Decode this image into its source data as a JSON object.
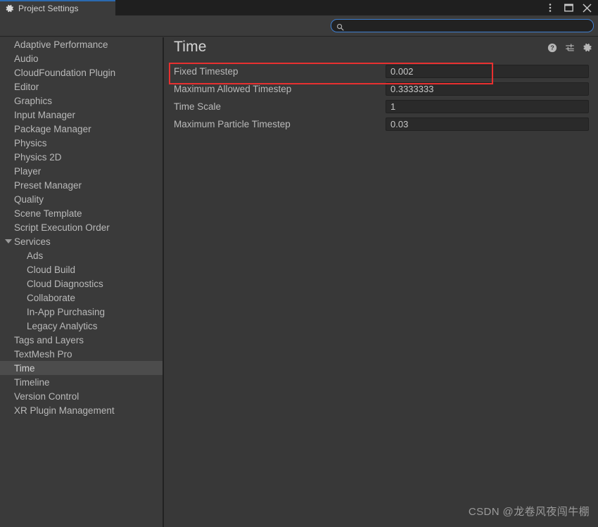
{
  "window": {
    "tab": {
      "label": "Project Settings",
      "icon": "gear-icon"
    },
    "controls": [
      {
        "name": "more-options-button",
        "icon": "kebab-menu-icon"
      },
      {
        "name": "maximize-button",
        "icon": "maximize-icon"
      },
      {
        "name": "close-button",
        "icon": "close-icon"
      }
    ],
    "accent_color": "#2b6ab0"
  },
  "search": {
    "value": "",
    "placeholder": "",
    "icon": "search-icon",
    "focus_border_color": "#3f7fd0"
  },
  "sidebar": {
    "items": [
      {
        "label": "Adaptive Performance",
        "depth": 0,
        "selected": false,
        "expandable": false
      },
      {
        "label": "Audio",
        "depth": 0,
        "selected": false,
        "expandable": false
      },
      {
        "label": "CloudFoundation Plugin",
        "depth": 0,
        "selected": false,
        "expandable": false
      },
      {
        "label": "Editor",
        "depth": 0,
        "selected": false,
        "expandable": false
      },
      {
        "label": "Graphics",
        "depth": 0,
        "selected": false,
        "expandable": false
      },
      {
        "label": "Input Manager",
        "depth": 0,
        "selected": false,
        "expandable": false
      },
      {
        "label": "Package Manager",
        "depth": 0,
        "selected": false,
        "expandable": false
      },
      {
        "label": "Physics",
        "depth": 0,
        "selected": false,
        "expandable": false
      },
      {
        "label": "Physics 2D",
        "depth": 0,
        "selected": false,
        "expandable": false
      },
      {
        "label": "Player",
        "depth": 0,
        "selected": false,
        "expandable": false
      },
      {
        "label": "Preset Manager",
        "depth": 0,
        "selected": false,
        "expandable": false
      },
      {
        "label": "Quality",
        "depth": 0,
        "selected": false,
        "expandable": false
      },
      {
        "label": "Scene Template",
        "depth": 0,
        "selected": false,
        "expandable": false
      },
      {
        "label": "Script Execution Order",
        "depth": 0,
        "selected": false,
        "expandable": false
      },
      {
        "label": "Services",
        "depth": 0,
        "selected": false,
        "expandable": true,
        "expanded": true
      },
      {
        "label": "Ads",
        "depth": 1,
        "selected": false,
        "expandable": false
      },
      {
        "label": "Cloud Build",
        "depth": 1,
        "selected": false,
        "expandable": false
      },
      {
        "label": "Cloud Diagnostics",
        "depth": 1,
        "selected": false,
        "expandable": false
      },
      {
        "label": "Collaborate",
        "depth": 1,
        "selected": false,
        "expandable": false
      },
      {
        "label": "In-App Purchasing",
        "depth": 1,
        "selected": false,
        "expandable": false
      },
      {
        "label": "Legacy Analytics",
        "depth": 1,
        "selected": false,
        "expandable": false
      },
      {
        "label": "Tags and Layers",
        "depth": 0,
        "selected": false,
        "expandable": false
      },
      {
        "label": "TextMesh Pro",
        "depth": 0,
        "selected": false,
        "expandable": false
      },
      {
        "label": "Time",
        "depth": 0,
        "selected": true,
        "expandable": false
      },
      {
        "label": "Timeline",
        "depth": 0,
        "selected": false,
        "expandable": false
      },
      {
        "label": "Version Control",
        "depth": 0,
        "selected": false,
        "expandable": false
      },
      {
        "label": "XR Plugin Management",
        "depth": 0,
        "selected": false,
        "expandable": false
      }
    ]
  },
  "content": {
    "title": "Time",
    "header_icons": [
      {
        "name": "help-icon",
        "label": "Help"
      },
      {
        "name": "preset-icon",
        "label": "Preset"
      },
      {
        "name": "settings-gear-icon",
        "label": "Settings"
      }
    ],
    "properties": [
      {
        "label": "Fixed Timestep",
        "value": "0.002",
        "highlighted": true
      },
      {
        "label": "Maximum Allowed Timestep",
        "value": "0.3333333",
        "highlighted": false
      },
      {
        "label": "Time Scale",
        "value": "1",
        "highlighted": false
      },
      {
        "label": "Maximum Particle Timestep",
        "value": "0.03",
        "highlighted": false
      }
    ]
  },
  "annotation": {
    "color": "#e83030",
    "target": "Fixed Timestep"
  },
  "watermark": {
    "text": "CSDN @龙卷风夜闯牛棚"
  }
}
